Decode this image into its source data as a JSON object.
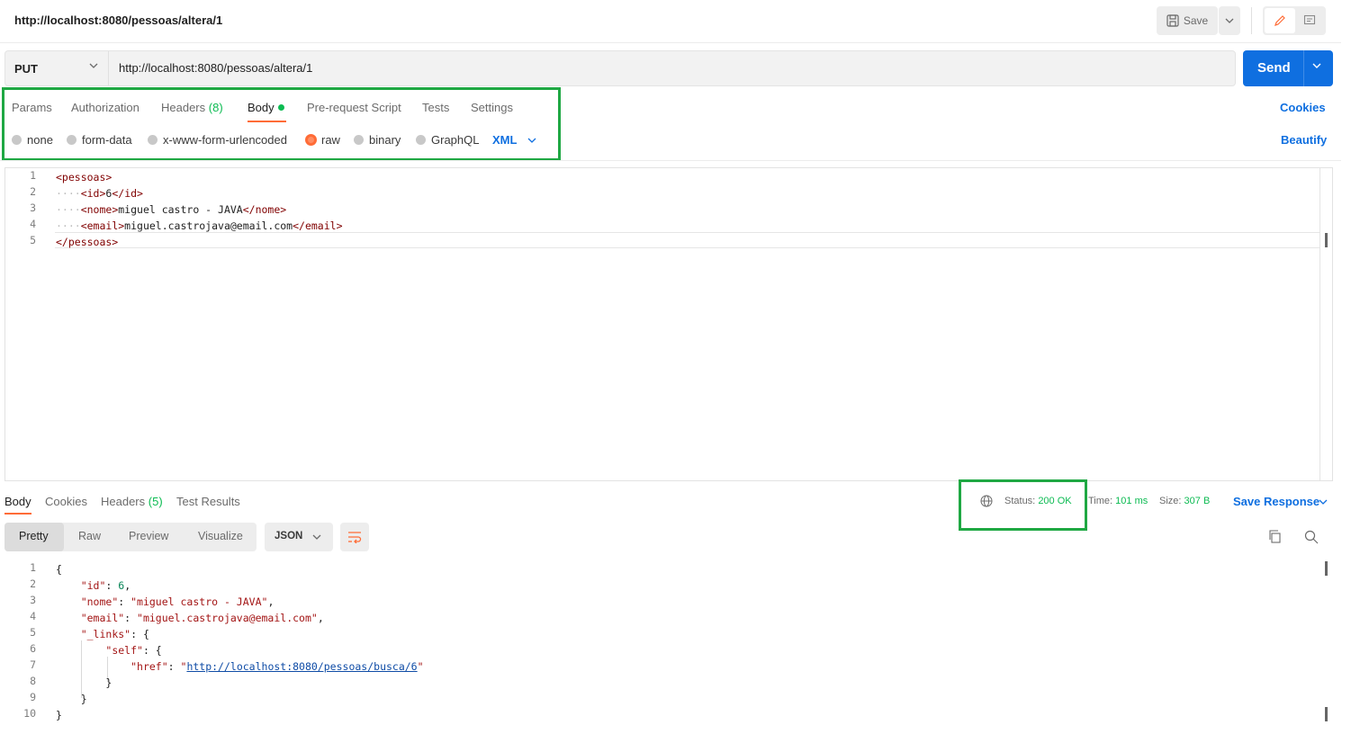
{
  "header": {
    "title": "http://localhost:8080/pessoas/altera/1",
    "save_label": "Save"
  },
  "request": {
    "method": "PUT",
    "url": "http://localhost:8080/pessoas/altera/1",
    "send_label": "Send"
  },
  "tabs": {
    "params": "Params",
    "authorization": "Authorization",
    "headers": "Headers",
    "headers_count": "(8)",
    "body": "Body",
    "pre_request": "Pre-request Script",
    "tests": "Tests",
    "settings": "Settings",
    "cookies": "Cookies",
    "beautify": "Beautify"
  },
  "body_types": {
    "none": "none",
    "form_data": "form-data",
    "urlencoded": "x-www-form-urlencoded",
    "raw": "raw",
    "binary": "binary",
    "graphql": "GraphQL",
    "format": "XML",
    "selected": "raw"
  },
  "request_body": {
    "line_numbers": [
      "1",
      "2",
      "3",
      "4",
      "5"
    ],
    "l1": "<pessoas>",
    "l2_open": "<id>",
    "l2_val": "6",
    "l2_close": "</id>",
    "l3_open": "<nome>",
    "l3_val": "miguel castro - JAVA",
    "l3_close": "</nome>",
    "l4_open": "<email>",
    "l4_val": "miguel.castrojava@email.com",
    "l4_close": "</email>",
    "l5": "</pessoas>"
  },
  "response": {
    "tabs": {
      "body": "Body",
      "cookies": "Cookies",
      "headers": "Headers",
      "headers_count": "(5)",
      "test_results": "Test Results"
    },
    "status_label": "Status:",
    "status_value": "200 OK",
    "time_label": "Time:",
    "time_value": "101 ms",
    "size_label": "Size:",
    "size_value": "307 B",
    "save_response": "Save Response",
    "formats": {
      "pretty": "Pretty",
      "raw": "Raw",
      "preview": "Preview",
      "visualize": "Visualize",
      "type": "JSON"
    },
    "line_numbers": [
      "1",
      "2",
      "3",
      "4",
      "5",
      "6",
      "7",
      "8",
      "9",
      "10"
    ],
    "json": {
      "open_brace": "{",
      "id_key": "\"id\"",
      "id_val": "6",
      "nome_key": "\"nome\"",
      "nome_val": "\"miguel castro - JAVA\"",
      "email_key": "\"email\"",
      "email_val": "\"miguel.castrojava@email.com\"",
      "links_key": "\"_links\"",
      "self_key": "\"self\"",
      "href_key": "\"href\"",
      "href_val": "http://localhost:8080/pessoas/busca/6",
      "close_brace": "}"
    }
  },
  "colors": {
    "accent": "#ff6c37",
    "primary": "#0f6fe0",
    "success": "#0cbb52",
    "highlight_box": "#1fa843"
  }
}
